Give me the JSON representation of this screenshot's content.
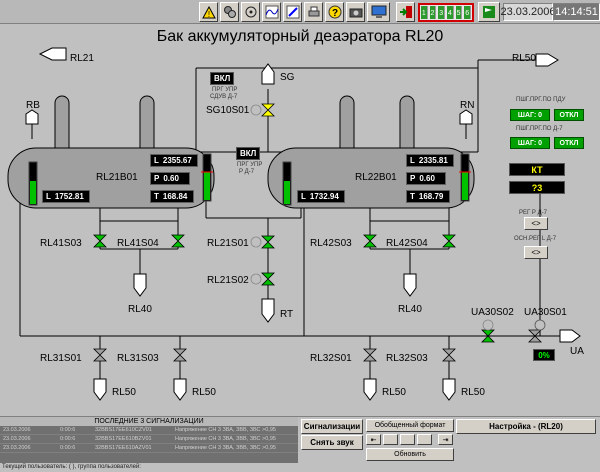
{
  "toolbar": {
    "icons": [
      "warning-icon",
      "gears-icon",
      "pump-icon",
      "trend-icon",
      "pen-icon",
      "printer-icon",
      "help-icon",
      "camera-icon",
      "computer-icon",
      "exit-icon",
      "flag-icon"
    ],
    "alarm_groups": [
      "1",
      "2",
      "3",
      "4",
      "5",
      "6"
    ],
    "date": "23.03.2006",
    "time": "14:14:51"
  },
  "title": "Бак аккумуляторный деаэратора  RL20",
  "labels": {
    "rl21": "RL21",
    "rl50_top": "RL50",
    "sg": "SG",
    "sg10s01": "SG10S01",
    "rb": "RB",
    "rn": "RN",
    "rl21b01": "RL21B01",
    "rl22b01": "RL22B01",
    "rl41s03": "RL41S03",
    "rl41s04": "RL41S04",
    "rl21s01": "RL21S01",
    "rl42s03": "RL42S03",
    "rl42s04": "RL42S04",
    "rl21s02": "RL21S02",
    "rt": "RT",
    "rl40_left": "RL40",
    "rl40_right": "RL40",
    "rl31s01": "RL31S01",
    "rl31s03": "RL31S03",
    "rl32s01": "RL32S01",
    "rl32s03": "RL32S03",
    "rl50_a": "RL50",
    "rl50_b": "RL50",
    "rl50_c": "RL50",
    "rl50_d": "RL50",
    "ua30s02": "UA30S02",
    "ua30s01": "UA30S01",
    "ua": "UA"
  },
  "status_tags": {
    "vkl_top": "ВКЛ",
    "vkl_top_sub1": "ПРГ УПР",
    "vkl_top_sub2": "СДУВ Д-7",
    "vkl_mid": "ВКЛ",
    "vkl_mid_sub1": "ПРГ УПР",
    "vkl_mid_sub2": "Р Д-7"
  },
  "tank1": {
    "L_top": "2355.67",
    "P": "0.60",
    "T": "168.84",
    "L_bottom": "1752.81",
    "level_fraction": 0.55
  },
  "tank2": {
    "L_top": "2335.81",
    "P": "0.60",
    "T": "168.79",
    "L_bottom": "1732.94",
    "level_fraction": 0.55
  },
  "meas_labels": {
    "L": "L",
    "P": "P",
    "T": "T"
  },
  "right_panel": {
    "pdu_label": "ПШГ.ПРГ.ПО  ПДУ",
    "d7_label": "ПШГ.ПРГ.ПО  Д-7",
    "shag1": "ШАГ: 0",
    "otkl1": "ОТКЛ",
    "shag2": "ШАГ: 0",
    "otkl2": "ОТКЛ",
    "kt": "КТ",
    "q3": "?3",
    "reg_label": "РЕГ  Р  Д-7",
    "reg_btn": "<>",
    "osn_label": "ОСН.РЕГ  L  Д-7",
    "osn_btn": "<>",
    "ua_pct": "0%"
  },
  "alarms": {
    "header": "ПОСЛЕДНИЕ 3 СИГНАЛИЗАЦИИ",
    "rows": [
      {
        "date": "23.03.2006",
        "time": "0:00:6",
        "code": "32BBS17EE610CZV01",
        "text": "Напряжение СН 3 ЗВА, ЗВВ, ЗВС >0,95"
      },
      {
        "date": "23.03.2006",
        "time": "0:00:6",
        "code": "32BBS17EE610BZV01",
        "text": "Напряжение СН 3 ЗВА, ЗВВ, ЗВС >0,95"
      },
      {
        "date": "23.03.2006",
        "time": "0:00:6",
        "code": "32BBS17EE610AZV01",
        "text": "Напряжение СН 3 ЗВА, ЗВВ, ЗВС >0,95"
      }
    ],
    "status_line": "Текущий пользователь: (  ),  группа пользователей: "
  },
  "buttons": {
    "signals": "Сигнализации",
    "mute": "Снять звук",
    "general_format": "Обобщенный формат",
    "settings": "Настройка - (RL20)",
    "refresh": "Обновить"
  }
}
